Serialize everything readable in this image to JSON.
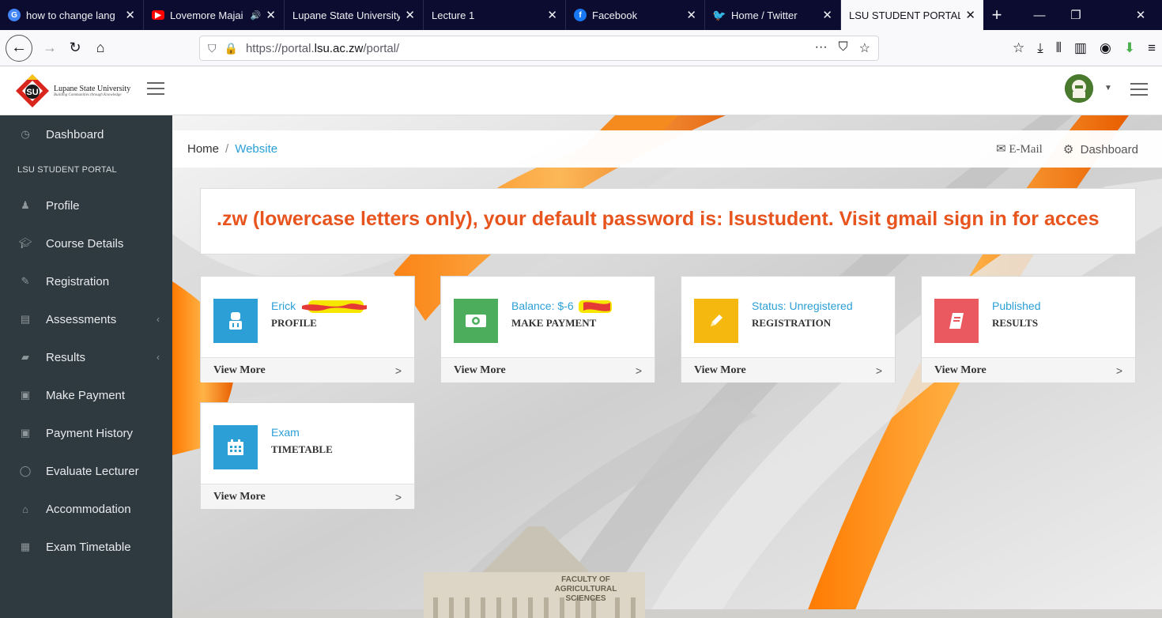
{
  "browser": {
    "tabs": [
      {
        "title": "how to change lang",
        "favicon": "google-icon",
        "favicon_color": "#4285f4"
      },
      {
        "title": "Lovemore Majai",
        "favicon": "youtube-icon",
        "favicon_color": "#ff0000",
        "audio": "🔊"
      },
      {
        "title": "Lupane State University",
        "favicon": "",
        "favicon_color": ""
      },
      {
        "title": "Lecture 1",
        "favicon": "",
        "favicon_color": ""
      },
      {
        "title": "Facebook",
        "favicon": "facebook-icon",
        "favicon_color": "#1877f2"
      },
      {
        "title": "Home / Twitter",
        "favicon": "twitter-icon",
        "favicon_color": "#1da1f2"
      },
      {
        "title": "LSU STUDENT PORTAL",
        "favicon": "",
        "favicon_color": ""
      }
    ],
    "url_prefix": "https://portal.",
    "url_host": "lsu.ac.zw",
    "url_path": "/portal/"
  },
  "portal": {
    "logo_name": "Lupane State University",
    "logo_tagline": "Building Communities through Knowledge"
  },
  "sidebar": {
    "items": [
      {
        "label": "Dashboard",
        "icon": "dashboard-icon"
      },
      {
        "label": "LSU STUDENT PORTAL",
        "heading": true
      },
      {
        "label": "Profile",
        "icon": "profile-icon"
      },
      {
        "label": "Course Details",
        "icon": "graduation-cap-icon"
      },
      {
        "label": "Registration",
        "icon": "pencil-icon"
      },
      {
        "label": "Assessments",
        "icon": "briefcase-icon",
        "chevron": "‹"
      },
      {
        "label": "Results",
        "icon": "book-icon",
        "chevron": "‹"
      },
      {
        "label": "Make Payment",
        "icon": "money-icon"
      },
      {
        "label": "Payment History",
        "icon": "money-icon"
      },
      {
        "label": "Evaluate Lecturer",
        "icon": "comment-icon"
      },
      {
        "label": "Accommodation",
        "icon": "home-icon"
      },
      {
        "label": "Exam Timetable",
        "icon": "calendar-icon"
      }
    ]
  },
  "breadcrumb": {
    "home": "Home",
    "sep": "/",
    "current": "Website"
  },
  "header_links": {
    "email": "E-Mail",
    "dashboard": "Dashboard"
  },
  "notice": ".zw (lowercase letters only), your default password is: lsustudent. Visit gmail sign in for acces",
  "cards": [
    {
      "line1": "Erick",
      "line2": "PROFILE",
      "foot": "View More",
      "color": "#2b9fd6",
      "icon": "user-icon"
    },
    {
      "line1": "Balance: $-6",
      "line2": "MAKE PAYMENT",
      "foot": "View More",
      "color": "#4cae5c",
      "icon": "money-icon"
    },
    {
      "line1": "Status: Unregistered",
      "line2": "REGISTRATION",
      "foot": "View More",
      "color": "#f5b80f",
      "icon": "pencil-icon"
    },
    {
      "line1": "Published",
      "line2": "RESULTS",
      "foot": "View More",
      "color": "#e9595f",
      "icon": "book-icon"
    },
    {
      "line1": "Exam",
      "line2": "TIMETABLE",
      "foot": "View More",
      "color": "#2b9fd6",
      "icon": "calendar-icon"
    }
  ],
  "building_label": "FACULTY OF AGRICULTURAL SCIENCES",
  "chevron": ">"
}
